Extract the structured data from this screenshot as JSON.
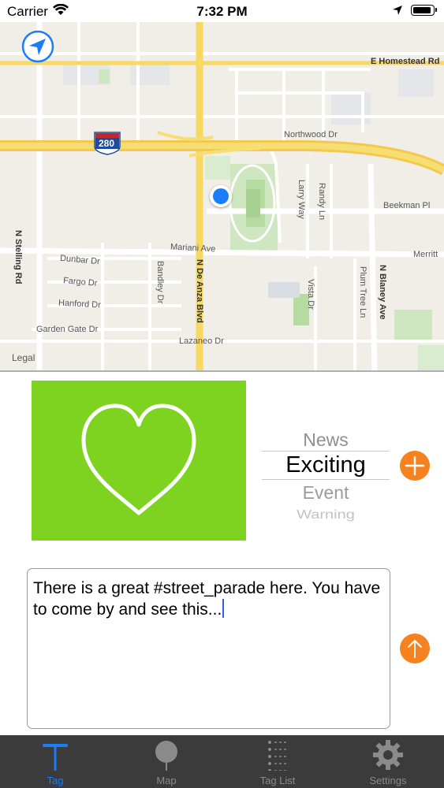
{
  "status_bar": {
    "carrier": "Carrier",
    "time": "7:32 PM"
  },
  "map": {
    "legal": "Legal",
    "streets": {
      "homestead": "E Homestead Rd",
      "northwood": "Northwood Dr",
      "beekman": "Beekman Pl",
      "merritt": "Merritt",
      "mariani": "Mariani Ave",
      "dunbar": "Dunbar Dr",
      "fargo": "Fargo Dr",
      "hanford": "Hanford Dr",
      "garden_gate": "Garden Gate Dr",
      "lazaneo": "Lazaneo Dr",
      "stelling": "N Stelling Rd",
      "de_anza": "N De Anza Blvd",
      "bandley": "Bandley Dr",
      "larry": "Larry Way",
      "randy": "Randy Ln",
      "vista": "Vista Dr",
      "plum_tree": "Plum Tree Ln",
      "blaney": "N Blaney Ave",
      "interstate": "280"
    }
  },
  "photo": {
    "icon": "heart-icon",
    "background": "#7ed321"
  },
  "picker": {
    "options": [
      "News",
      "Exciting",
      "Event",
      "Warning"
    ],
    "selected": "Exciting"
  },
  "message": {
    "text": "There is a great #street_parade here. You have to come by and see this..."
  },
  "tabs": [
    {
      "label": "Tag",
      "icon": "tag-pin-icon",
      "active": true
    },
    {
      "label": "Map",
      "icon": "map-pin-icon",
      "active": false
    },
    {
      "label": "Tag List",
      "icon": "list-icon",
      "active": false
    },
    {
      "label": "Settings",
      "icon": "gear-icon",
      "active": false
    }
  ],
  "colors": {
    "accent": "#f5821f",
    "active_tab": "#1a7dfa",
    "tab_bar": "#3b3b3b"
  }
}
